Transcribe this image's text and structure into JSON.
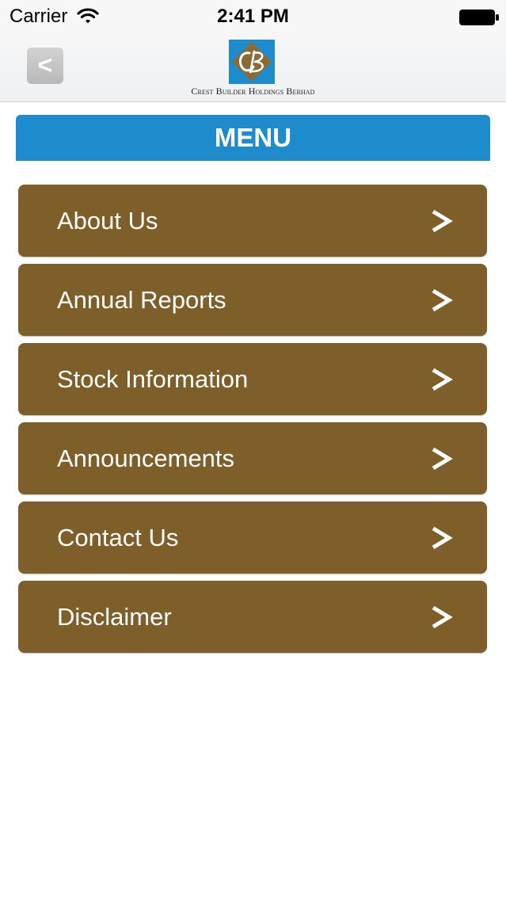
{
  "status_bar": {
    "carrier": "Carrier",
    "time": "2:41 PM",
    "wifi_icon": "wifi-icon",
    "battery_icon": "battery-icon"
  },
  "nav": {
    "back_label": "<",
    "logo_icon": "cb-logo-icon",
    "company_name": "Crest Builder Holdings Berhad",
    "logo_colors": {
      "blue": "#1e8ccc",
      "brown": "#8b6b33"
    }
  },
  "menu": {
    "title": "MENU",
    "header_color": "#1e8ccc",
    "item_color": "#7e5e29",
    "items": [
      {
        "label": "About Us"
      },
      {
        "label": "Annual Reports"
      },
      {
        "label": "Stock Information"
      },
      {
        "label": "Announcements"
      },
      {
        "label": "Contact Us"
      },
      {
        "label": "Disclaimer"
      }
    ],
    "chevron_icon": "chevron-right-icon"
  }
}
